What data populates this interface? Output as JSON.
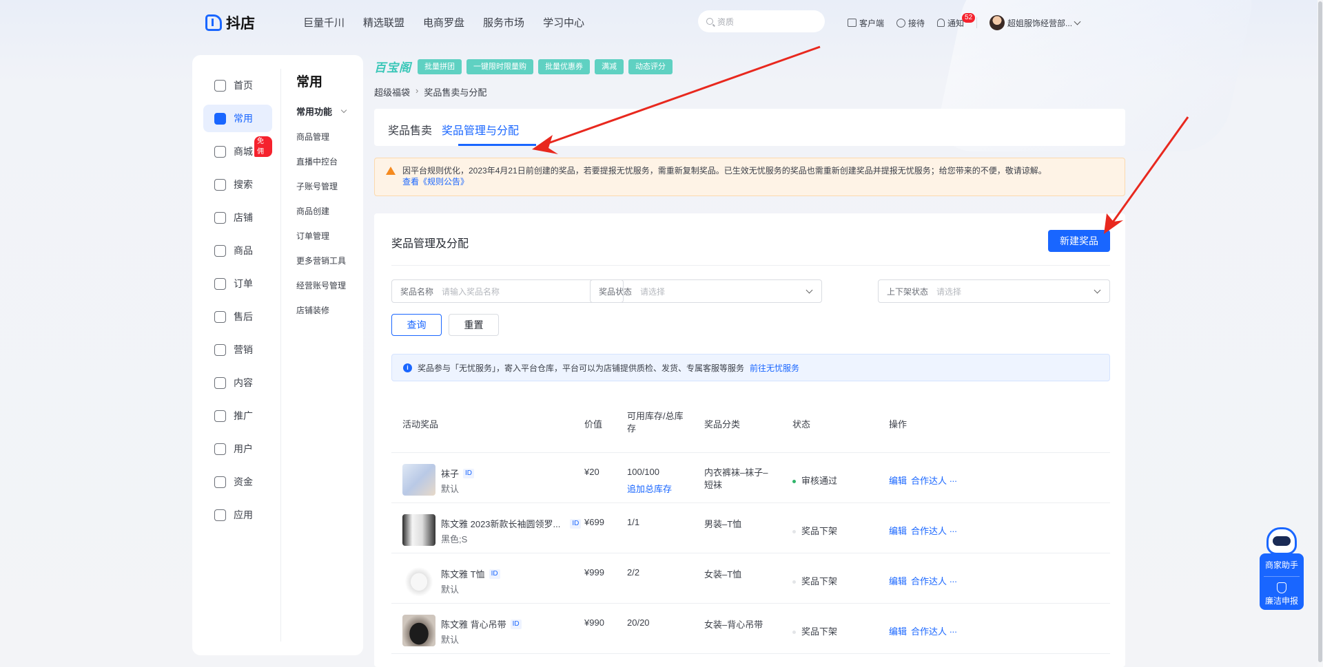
{
  "topbar": {
    "logo_text": "抖店",
    "nav": [
      "巨量千川",
      "精选联盟",
      "电商罗盘",
      "服务市场",
      "学习中心"
    ],
    "search_placeholder": "资质",
    "actions": {
      "client": "客户端",
      "reception": "接待",
      "notify": "通知",
      "notify_count": "52",
      "account": "超姐服饰经营部..."
    }
  },
  "sidebar": {
    "nav": [
      {
        "label": "首页",
        "icon": "home-icon"
      },
      {
        "label": "常用",
        "icon": "star-icon"
      },
      {
        "label": "商城",
        "icon": "mall-icon",
        "badge": "免佣"
      },
      {
        "label": "搜索",
        "icon": "search-icon"
      },
      {
        "label": "店铺",
        "icon": "store-icon"
      },
      {
        "label": "商品",
        "icon": "goods-icon"
      },
      {
        "label": "订单",
        "icon": "order-icon"
      },
      {
        "label": "售后",
        "icon": "aftersale-icon"
      },
      {
        "label": "营销",
        "icon": "marketing-icon"
      },
      {
        "label": "内容",
        "icon": "content-icon"
      },
      {
        "label": "推广",
        "icon": "promote-icon"
      },
      {
        "label": "用户",
        "icon": "user-icon"
      },
      {
        "label": "资金",
        "icon": "wallet-icon"
      },
      {
        "label": "应用",
        "icon": "app-icon"
      }
    ],
    "active_index": 1,
    "panel_title": "常用",
    "group_title": "常用功能",
    "functions": [
      "商品管理",
      "直播中控台",
      "子账号管理",
      "商品创建",
      "订单管理",
      "更多营销工具",
      "经营账号管理",
      "店铺装修"
    ]
  },
  "promo": {
    "logo": "百宝阁",
    "tags": [
      "批量拼团",
      "一键限时限量购",
      "批量优惠券",
      "满减",
      "动态评分"
    ]
  },
  "breadcrumb": {
    "parent": "超级福袋",
    "current": "奖品售卖与分配"
  },
  "tabs": [
    "奖品售卖",
    "奖品管理与分配"
  ],
  "active_tab": 1,
  "notice": {
    "text": "因平台规则优化，2023年4月21日前创建的奖品，若要提报无忧服务，需重新复制奖品。已生效无忧服务的奖品也需重新创建奖品并提报无忧服务；给您带来的不便，敬请谅解。",
    "link": "查看《规则公告》"
  },
  "card": {
    "title": "奖品管理及分配",
    "new_button": "新建奖品",
    "filters": [
      {
        "label": "奖品名称",
        "placeholder": "请输入奖品名称"
      },
      {
        "label": "奖品状态",
        "placeholder": "请选择"
      },
      {
        "label": "上下架状态",
        "placeholder": "请选择"
      }
    ],
    "query_button": "查询",
    "reset_button": "重置",
    "info_text": "奖品参与「无忧服务」，寄入平台仓库，平台可以为店铺提供质检、发货、专属客服等服务",
    "info_link": "前往无忧服务"
  },
  "table": {
    "headers": [
      "活动奖品",
      "价值",
      "可用库存/总库存",
      "奖品分类",
      "状态",
      "操作"
    ],
    "rows": [
      {
        "name": "袜子",
        "id": "ID",
        "spec": "默认",
        "price": "¥20",
        "stock": "100/100",
        "stock_link": "追加总库存",
        "category": "内衣裤袜–袜子–短袜",
        "status": "审核通过",
        "status_color": "#2fb46a",
        "edit": "编辑",
        "coop": "合作达人",
        "more": "..."
      },
      {
        "name": "陈文雅 2023新款长袖圆领罗...",
        "id": "ID",
        "spec": "黑色;S",
        "price": "¥699",
        "stock": "1/1",
        "stock_link": "",
        "category": "男装–T恤",
        "status": "奖品下架",
        "status_color": "#d9dce1",
        "edit": "编辑",
        "coop": "合作达人",
        "more": "..."
      },
      {
        "name": "陈文雅 T恤",
        "id": "ID",
        "spec": "默认",
        "price": "¥999",
        "stock": "2/2",
        "stock_link": "",
        "category": "女装–T恤",
        "status": "奖品下架",
        "status_color": "#d9dce1",
        "edit": "编辑",
        "coop": "合作达人",
        "more": "..."
      },
      {
        "name": "陈文雅 背心吊带",
        "id": "ID",
        "spec": "默认",
        "price": "¥990",
        "stock": "20/20",
        "stock_link": "",
        "category": "女装–背心吊带",
        "status": "奖品下架",
        "status_color": "#d9dce1",
        "edit": "编辑",
        "coop": "合作达人",
        "more": "..."
      }
    ]
  },
  "assistant": {
    "label": "商家助手",
    "report": "廉洁申报"
  },
  "colors": {
    "primary": "#1966ff",
    "promo": "#5fd1c2",
    "warning_bg": "#fef3e6",
    "arrow": "#e8281e"
  }
}
